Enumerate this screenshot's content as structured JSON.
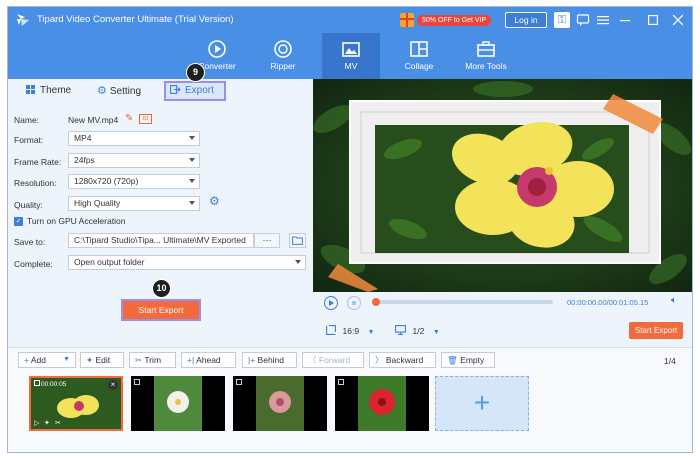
{
  "app": {
    "title": "Tipard Video Converter Ultimate (Trial Version)",
    "promo": "50% OFF to Get VIP",
    "login": "Log in"
  },
  "nav": {
    "items": [
      {
        "label": "Converter"
      },
      {
        "label": "Ripper"
      },
      {
        "label": "MV"
      },
      {
        "label": "Collage"
      },
      {
        "label": "More Tools"
      }
    ],
    "active": "MV"
  },
  "tabs": {
    "theme": "Theme",
    "setting": "Setting",
    "export": "Export"
  },
  "form": {
    "name_label": "Name:",
    "name_value": "New MV.mp4",
    "format_label": "Format:",
    "format_value": "MP4",
    "frame_rate_label": "Frame Rate:",
    "frame_rate_value": "24fps",
    "resolution_label": "Resolution:",
    "resolution_value": "1280x720 (720p)",
    "quality_label": "Quality:",
    "quality_value": "High Quality",
    "gpu_label": "Turn on GPU Acceleration",
    "gpu_checked": true,
    "save_label": "Save to:",
    "save_value": "C:\\Tipard Studio\\Tipa... Ultimate\\MV Exported",
    "browse": "···",
    "complete_label": "Complete:",
    "complete_value": "Open output folder",
    "start_export": "Start Export"
  },
  "badges": {
    "step9": "9",
    "step10": "10"
  },
  "player": {
    "time": "00:00:00.00/00:01:05.15",
    "aspect": "16:9",
    "page": "1/2",
    "start_export": "Start Export",
    "progress": 0.0
  },
  "toolbar": {
    "add": "Add",
    "edit": "Edit",
    "trim": "Trim",
    "ahead": "Ahead",
    "behind": "Behind",
    "forward": "Forward",
    "backward": "Backward",
    "empty": "Empty",
    "page_count": "1/4"
  },
  "timeline": {
    "clip1_time": "00:00:05"
  },
  "colors": {
    "accent": "#4a8fe6",
    "orange": "#f26a3d",
    "highlight": "#9b8fe8"
  }
}
